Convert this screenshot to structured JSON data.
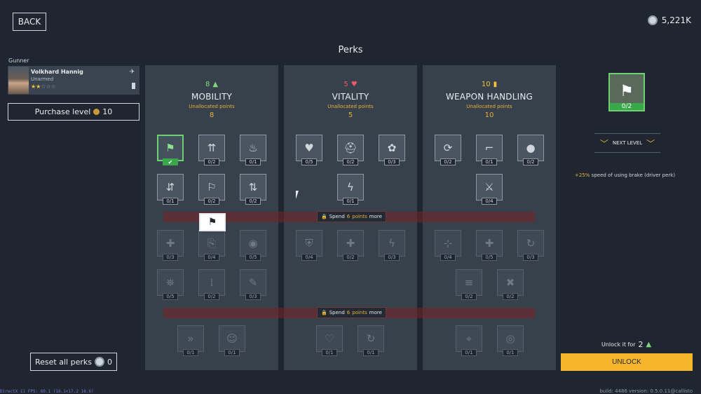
{
  "header": {
    "back_label": "BACK",
    "currency_value": "5,221K",
    "title": "Perks"
  },
  "crew": {
    "role": "Gunner",
    "name": "Volkhard Hannig",
    "weapon": "Unarmed",
    "stars_filled": "★★",
    "stars_empty": "☆☆☆",
    "purchase_label": "Purchase level",
    "purchase_cost": "10"
  },
  "columns": [
    {
      "title": "MOBILITY",
      "points": "8",
      "icon": "boot-icon",
      "unalloc_label": "Unallocated points",
      "unalloc_value": "8",
      "perks": [
        {
          "name": "perk-brake-speed",
          "glyph": "⚑",
          "count": "",
          "state": "active"
        },
        {
          "name": "perk-climb-speed",
          "glyph": "⇈",
          "count": "0/2",
          "state": "normal"
        },
        {
          "name": "perk-fire-resist",
          "glyph": "♨",
          "count": "0/1",
          "state": "normal"
        },
        {
          "name": "perk-seat-change",
          "glyph": "⇵",
          "count": "0/1",
          "state": "normal"
        },
        {
          "name": "perk-sprint",
          "glyph": "⚐",
          "count": "0/2",
          "state": "normal"
        },
        {
          "name": "perk-seat-swap",
          "glyph": "⇅",
          "count": "0/2",
          "state": "normal"
        },
        {
          "name": "perk-heal-speed",
          "glyph": "✚",
          "count": "0/3",
          "state": "locked"
        },
        {
          "name": "perk-door-exit",
          "glyph": "⎘",
          "count": "0/4",
          "state": "locked"
        },
        {
          "name": "perk-stamina-recovery",
          "glyph": "◉",
          "count": "0/5",
          "state": "locked"
        },
        {
          "name": "perk-extinguisher",
          "glyph": "⛯",
          "count": "0/5",
          "state": "locked"
        },
        {
          "name": "perk-gear-shift",
          "glyph": "⁞",
          "count": "0/2",
          "state": "locked"
        },
        {
          "name": "perk-repair-speed",
          "glyph": "✎",
          "count": "0/3",
          "state": "locked"
        },
        {
          "name": "perk-run-speed",
          "glyph": "»",
          "count": "0/1",
          "state": "locked"
        },
        {
          "name": "perk-ghost",
          "glyph": "☺",
          "count": "0/1",
          "state": "locked"
        }
      ]
    },
    {
      "title": "VITALITY",
      "points": "5",
      "icon": "heart-icon",
      "unalloc_label": "Unallocated points",
      "unalloc_value": "5",
      "perks": [
        {
          "name": "perk-heart-regen",
          "glyph": "♥",
          "count": "0/5",
          "state": "normal"
        },
        {
          "name": "perk-helmet",
          "glyph": "⛑",
          "count": "0/2",
          "state": "normal"
        },
        {
          "name": "perk-lungs",
          "glyph": "✿",
          "count": "0/3",
          "state": "normal"
        },
        {
          "name": "perk-energy-regen",
          "glyph": "ϟ",
          "count": "0/1",
          "state": "normal"
        },
        {
          "name": "perk-armor",
          "glyph": "⛨",
          "count": "0/4",
          "state": "locked"
        },
        {
          "name": "perk-health-boost",
          "glyph": "✚",
          "count": "0/2",
          "state": "locked"
        },
        {
          "name": "perk-energy-boost",
          "glyph": "ϟ",
          "count": "0/3",
          "state": "locked"
        },
        {
          "name": "perk-revive",
          "glyph": "♡",
          "count": "0/1",
          "state": "locked"
        },
        {
          "name": "perk-recovery",
          "glyph": "↻",
          "count": "0/1",
          "state": "locked"
        }
      ]
    },
    {
      "title": "WEAPON HANDLING",
      "points": "10",
      "icon": "ammo-icon",
      "unalloc_label": "Unallocated points",
      "unalloc_value": "10",
      "perks": [
        {
          "name": "perk-weapon-swap",
          "glyph": "⟳",
          "count": "0/2",
          "state": "normal"
        },
        {
          "name": "perk-pistol",
          "glyph": "⌐",
          "count": "0/1",
          "state": "normal"
        },
        {
          "name": "perk-grenade",
          "glyph": "●",
          "count": "0/2",
          "state": "normal"
        },
        {
          "name": "perk-knife",
          "glyph": "⚔",
          "count": "0/4",
          "state": "normal"
        },
        {
          "name": "perk-aim",
          "glyph": "⊹",
          "count": "0/4",
          "state": "locked"
        },
        {
          "name": "perk-medkit",
          "glyph": "✚",
          "count": "0/5",
          "state": "locked"
        },
        {
          "name": "perk-reload",
          "glyph": "↻",
          "count": "0/3",
          "state": "locked"
        },
        {
          "name": "perk-ammo-carry",
          "glyph": "≡",
          "count": "0/2",
          "state": "locked"
        },
        {
          "name": "perk-tools",
          "glyph": "✖",
          "count": "0/2",
          "state": "locked"
        },
        {
          "name": "perk-focus",
          "glyph": "⌖",
          "count": "0/1",
          "state": "locked"
        },
        {
          "name": "perk-vision",
          "glyph": "◎",
          "count": "0/1",
          "state": "locked"
        }
      ]
    }
  ],
  "spend": {
    "prefix": "Spend",
    "value": "6",
    "unit": "points",
    "suffix": "more"
  },
  "detail": {
    "count": "0/2",
    "next_level_label": "NEXT LEVEL",
    "desc_highlight": "+25%",
    "desc_text": "speed of using brake (driver perk)",
    "unlock_for_label": "Unlock it for",
    "unlock_cost": "2",
    "unlock_label": "UNLOCK"
  },
  "footer": {
    "reset_label": "Reset all perks",
    "reset_cost": "0",
    "fps_text": "DirectX 11 FPS: 60.1 (16.1<17.2 16.6)",
    "build_text": "build: 4486 version: 0.5.0.11@callisto"
  },
  "colors": {
    "accent": "#f7b52b",
    "active": "#6fd06f",
    "vitality": "#f05a6a",
    "panel": "#37414b",
    "bg": "#1f2630"
  }
}
